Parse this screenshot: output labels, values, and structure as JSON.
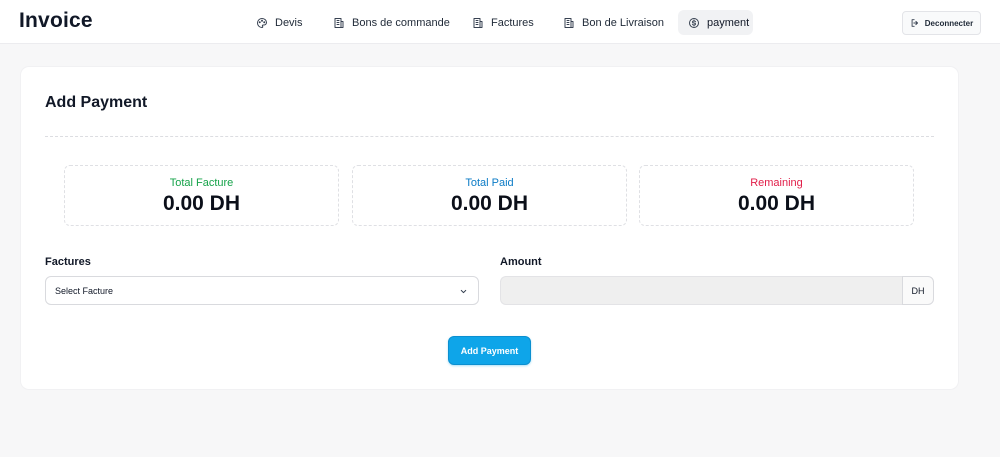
{
  "app": {
    "title": "Invoice"
  },
  "nav": {
    "items": [
      {
        "label": "Devis",
        "icon": "palette-icon",
        "active": false
      },
      {
        "label": "Bons de commande",
        "icon": "building-icon",
        "active": false
      },
      {
        "label": "Factures",
        "icon": "building-icon",
        "active": false
      },
      {
        "label": "Bon de Livraison",
        "icon": "building-icon",
        "active": false
      },
      {
        "label": "payment",
        "icon": "dollar-circle-icon",
        "active": true
      }
    ],
    "logout_label": "Deconnecter"
  },
  "page": {
    "title": "Add Payment",
    "stats": [
      {
        "label": "Total Facture",
        "value": "0.00 DH",
        "color": "#16a34a"
      },
      {
        "label": "Total Paid",
        "value": "0.00 DH",
        "color": "#0b7bc6"
      },
      {
        "label": "Remaining",
        "value": "0.00 DH",
        "color": "#e11d48"
      }
    ],
    "factures_label": "Factures",
    "factures_selected": "Select Facture",
    "amount_label": "Amount",
    "amount_value": "",
    "amount_suffix": "DH",
    "submit_label": "Add Payment"
  },
  "colors": {
    "accent": "#0ea5e9",
    "background": "#f7f7f8",
    "card": "#ffffff"
  }
}
